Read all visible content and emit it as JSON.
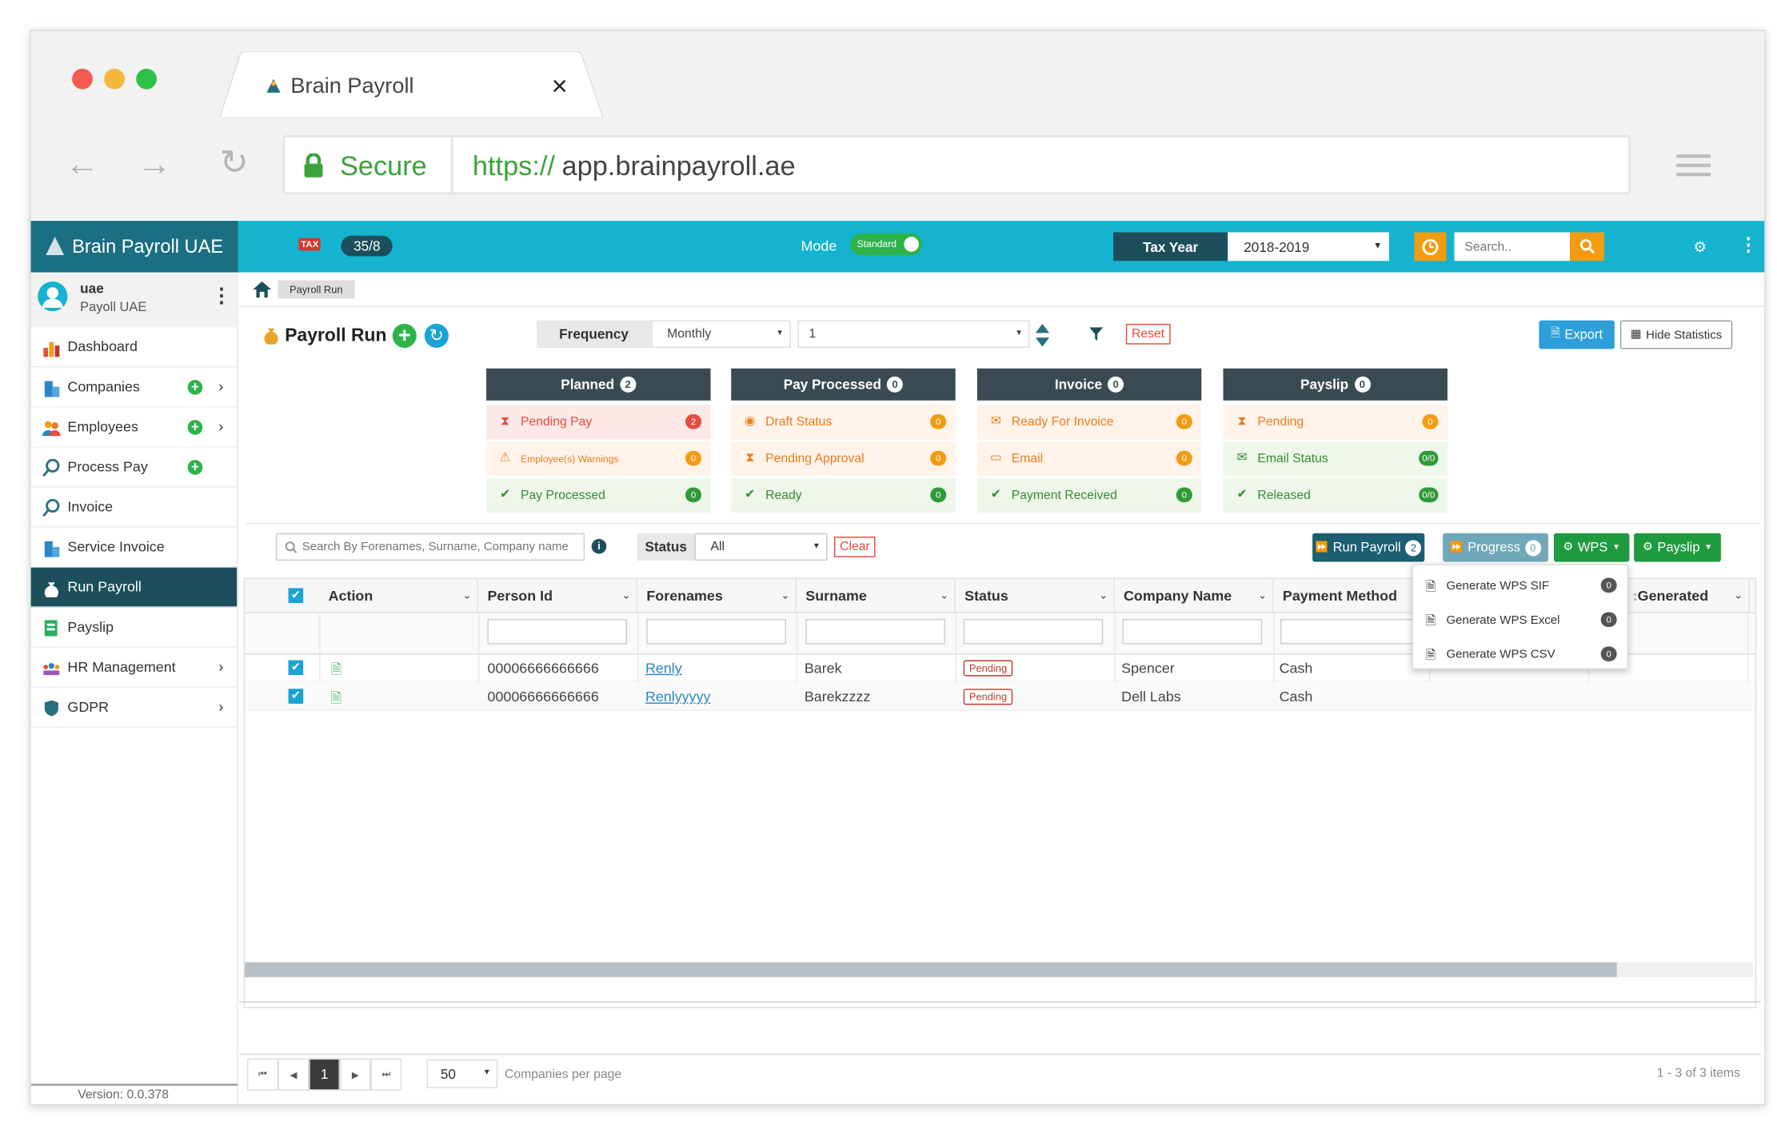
{
  "browser": {
    "tab_title": "Brain Payroll",
    "secure_label": "Secure",
    "url_scheme": "https://",
    "url_host": "app.brainpayroll.ae"
  },
  "topbar": {
    "brand": "Brain Payroll UAE",
    "tax_label": "TAX",
    "tax_counter": "35/8",
    "mode_label": "Mode",
    "mode_toggle": "Standard",
    "tax_year_label": "Tax Year",
    "tax_year_value": "2018-2019",
    "search_placeholder": "Search.."
  },
  "user": {
    "name": "uae",
    "role": "Payoll UAE"
  },
  "sidebar": {
    "items": [
      {
        "label": "Dashboard"
      },
      {
        "label": "Companies"
      },
      {
        "label": "Employees"
      },
      {
        "label": "Process Pay"
      },
      {
        "label": "Invoice"
      },
      {
        "label": "Service Invoice"
      },
      {
        "label": "Run Payroll"
      },
      {
        "label": "Payslip"
      },
      {
        "label": "HR Management"
      },
      {
        "label": "GDPR"
      }
    ],
    "version": "Version: 0.0.378"
  },
  "breadcrumb": {
    "current": "Payroll Run"
  },
  "page": {
    "title": "Payroll Run",
    "frequency_label": "Frequency",
    "frequency_value": "Monthly",
    "period_value": "1",
    "reset_label": "Reset",
    "export_label": "Export",
    "hide_stats_label": "Hide Statistics"
  },
  "stats": {
    "planned": {
      "title": "Planned",
      "count": "2",
      "rows": [
        {
          "label": "Pending Pay",
          "value": "2"
        },
        {
          "label": "Employee(s) Warnings",
          "value": "0"
        },
        {
          "label": "Pay Processed",
          "value": "0"
        }
      ]
    },
    "pay_processed": {
      "title": "Pay Processed",
      "count": "0",
      "rows": [
        {
          "label": "Draft Status",
          "value": "0"
        },
        {
          "label": "Pending Approval",
          "value": "0"
        },
        {
          "label": "Ready",
          "value": "0"
        }
      ]
    },
    "invoice": {
      "title": "Invoice",
      "count": "0",
      "rows": [
        {
          "label": "Ready For Invoice",
          "value": "0"
        },
        {
          "label": "Email",
          "value": "0"
        },
        {
          "label": "Payment Received",
          "value": "0"
        }
      ]
    },
    "payslip": {
      "title": "Payslip",
      "count": "0",
      "rows": [
        {
          "label": "Pending",
          "value": "0"
        },
        {
          "label": "Email Status",
          "value": "0/0"
        },
        {
          "label": "Released",
          "value": "0/0"
        }
      ]
    }
  },
  "toolbar": {
    "search_placeholder": "Search By Forenames, Surname, Company name",
    "status_label": "Status",
    "status_value": "All",
    "clear_label": "Clear",
    "run_payroll_label": "Run Payroll",
    "run_payroll_count": "2",
    "progress_label": "Progress",
    "progress_count": "0",
    "wps_label": "WPS",
    "payslip_label": "Payslip"
  },
  "wps_menu": [
    {
      "label": "Generate WPS SIF",
      "count": "0"
    },
    {
      "label": "Generate WPS Excel",
      "count": "0"
    },
    {
      "label": "Generate WPS CSV",
      "count": "0"
    }
  ],
  "grid": {
    "columns": [
      "Action",
      "Person Id",
      "Forenames",
      "Surname",
      "Status",
      "Company Name",
      "Payment Method",
      "Generated"
    ],
    "rows": [
      {
        "person_id": "00006666666666",
        "forenames": "Renly",
        "surname": "Barek",
        "status": "Pending",
        "company": "Spencer",
        "payment": "Cash"
      },
      {
        "person_id": "00006666666666",
        "forenames": "Renlyyyyy",
        "surname": "Barekzzzz",
        "status": "Pending",
        "company": "Dell Labs",
        "payment": "Cash"
      }
    ]
  },
  "pager": {
    "current_page": "1",
    "page_size": "50",
    "per_page_label": "Companies per page",
    "summary": "1 - 3 of 3 items"
  },
  "colors": {
    "topbar": "#15b3d0",
    "sidebar_active": "#1c4f5b",
    "card_header": "#394a52",
    "accent_green": "#2eb34a",
    "accent_orange": "#f39c12",
    "run_payroll_button": "#1c5f72",
    "progress_button": "#6fa8b8",
    "wps_button": "#1e9b3e",
    "export_button": "#2e9fd8"
  }
}
